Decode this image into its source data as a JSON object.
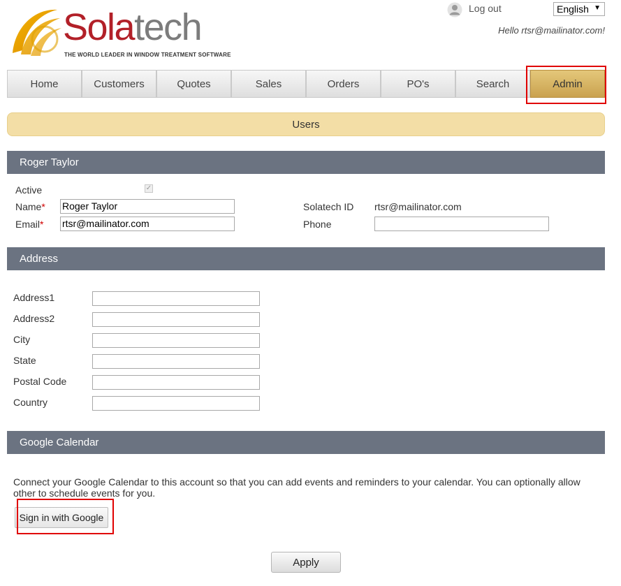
{
  "brand": {
    "logo_part1": "Sola",
    "logo_part2": "tech",
    "tagline": "THE WORLD LEADER IN WINDOW TREATMENT SOFTWARE",
    "accent_red": "#b22028",
    "accent_gold": "#caa24f"
  },
  "user": {
    "logout_label": "Log out",
    "language": "English",
    "greeting": "Hello rtsr@mailinator.com!"
  },
  "nav": {
    "items": [
      {
        "label": "Home"
      },
      {
        "label": "Customers"
      },
      {
        "label": "Quotes"
      },
      {
        "label": "Sales"
      },
      {
        "label": "Orders"
      },
      {
        "label": "PO's"
      },
      {
        "label": "Search"
      },
      {
        "label": "Admin",
        "active": true
      }
    ]
  },
  "page": {
    "banner_title": "Users"
  },
  "user_section": {
    "header": "Roger Taylor",
    "active_label": "Active",
    "active_checked": true,
    "name_label": "Name",
    "name_value": "Roger Taylor",
    "email_label": "Email",
    "email_value": "rtsr@mailinator.com",
    "required_marker": "*",
    "solatech_id_label": "Solatech ID",
    "solatech_id_value": "rtsr@mailinator.com",
    "phone_label": "Phone",
    "phone_value": ""
  },
  "address_section": {
    "header": "Address",
    "fields": [
      {
        "label": "Address1",
        "value": ""
      },
      {
        "label": "Address2",
        "value": ""
      },
      {
        "label": "City",
        "value": ""
      },
      {
        "label": "State",
        "value": ""
      },
      {
        "label": "Postal Code",
        "value": ""
      },
      {
        "label": "Country",
        "value": ""
      }
    ]
  },
  "calendar_section": {
    "header": "Google Calendar",
    "description": "Connect your Google Calendar to this account so that you can add events and reminders to your calendar. You can optionally allow other to schedule events for you.",
    "signin_label": "Sign in with Google"
  },
  "footer": {
    "apply_label": "Apply"
  }
}
